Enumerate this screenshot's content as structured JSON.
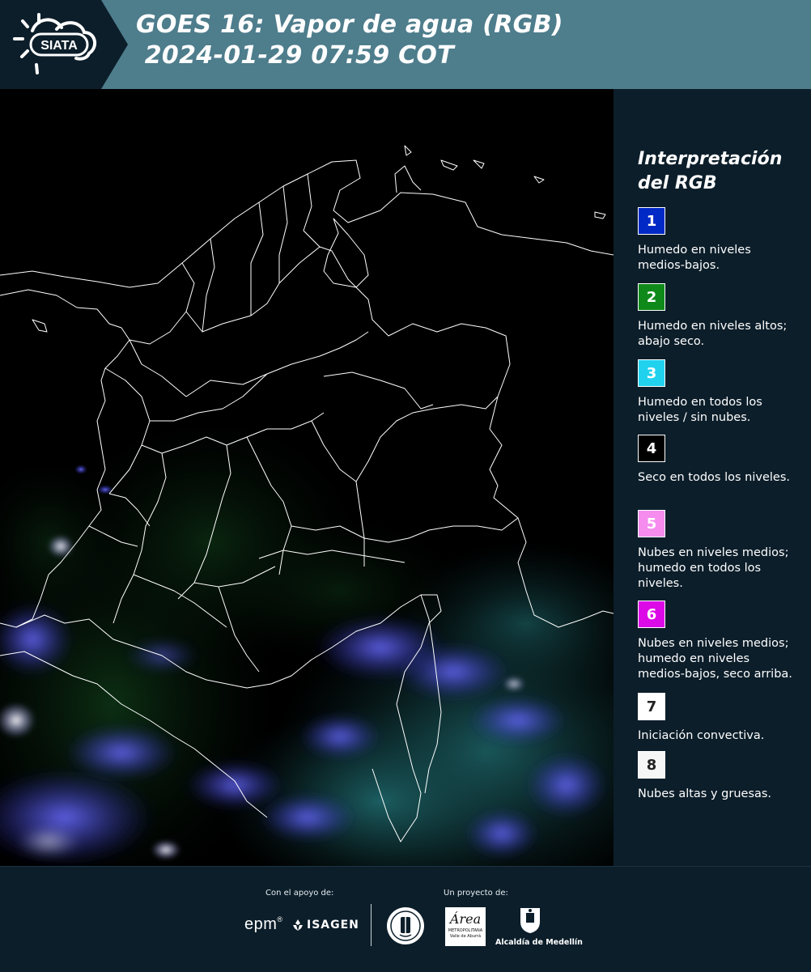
{
  "header": {
    "logo_text": "SIATA",
    "title_line1": "GOES 16: Vapor de agua (RGB)",
    "title_line2": " 2024-01-29 07:59 COT",
    "background": "#4e7d8c"
  },
  "legend": {
    "title_line1": "Interpretación",
    "title_line2": "del RGB",
    "items": [
      {
        "number": "1",
        "color": "#0029c6",
        "text_color": "#ffffff",
        "description": "Humedo en niveles medios-bajos."
      },
      {
        "number": "2",
        "color": "#0f8a1a",
        "text_color": "#ffffff",
        "description": "Humedo en niveles altos; abajo seco."
      },
      {
        "number": "3",
        "color": "#21d2ee",
        "text_color": "#ffffff",
        "description": "Humedo en todos los niveles / sin nubes."
      },
      {
        "number": "4",
        "color": "#000000",
        "text_color": "#ffffff",
        "description": "Seco en todos los niveles."
      },
      {
        "number": "5",
        "color": "#f58cee",
        "text_color": "#ffffff",
        "description": "Nubes en niveles medios; humedo en todos los niveles."
      },
      {
        "number": "6",
        "color": "#dc0ae6",
        "text_color": "#ffffff",
        "description": "Nubes en niveles medios; humedo en niveles medios-bajos, seco arriba."
      },
      {
        "number": "7",
        "color": "#ffffff",
        "text_color": "#222222",
        "description": "Iniciación convectiva."
      },
      {
        "number": "8",
        "color": "#f6f6f6",
        "text_color": "#222222",
        "description": "Nubes altas y gruesas."
      }
    ]
  },
  "footer": {
    "support_label": "Con el apoyo de:",
    "project_label": "Un proyecto de:",
    "sponsor_epm": "epm",
    "sponsor_isagen": "ISAGEN",
    "area_logo_text": "Área",
    "area_caption": "METROPOLITANA",
    "area_subcaption": "Valle de Aburrá",
    "alcaldia_label": "Alcaldía de Medellín"
  },
  "colors": {
    "page_background": "#0c1e2a",
    "map_background": "#000000",
    "map_borders": "#ffffff",
    "cloud_blue": "#5a5cff",
    "moisture_teal": "#1c5e63"
  }
}
